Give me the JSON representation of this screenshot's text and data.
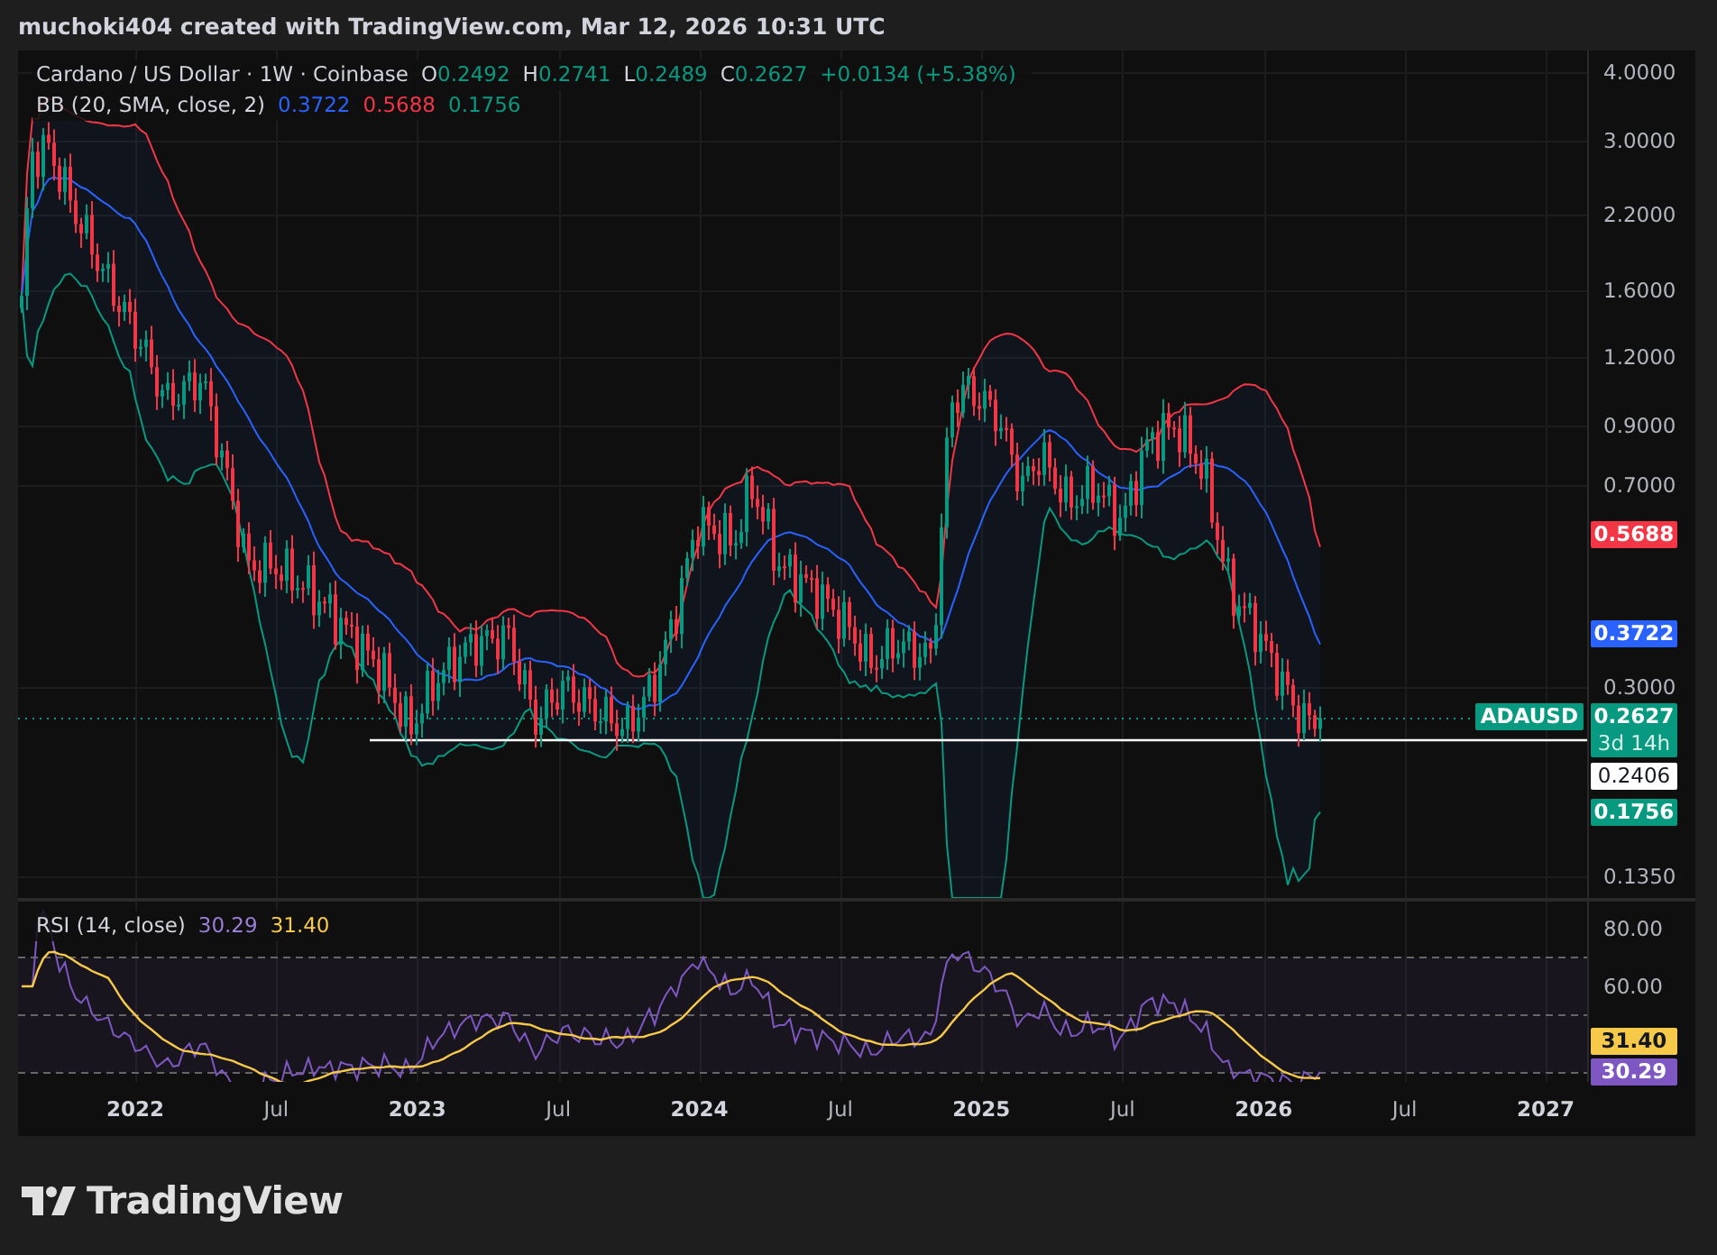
{
  "header": {
    "text": "muchoki404 created with TradingView.com, Mar 12, 2026 10:31 UTC"
  },
  "legend": {
    "symbol": "Cardano / US Dollar · 1W · Coinbase",
    "ohlc": [
      {
        "label": "O",
        "value": "0.2492"
      },
      {
        "label": "H",
        "value": "0.2741"
      },
      {
        "label": "L",
        "value": "0.2489"
      },
      {
        "label": "C",
        "value": "0.2627"
      }
    ],
    "change": "+0.0134 (+5.38%)"
  },
  "bb_legend": {
    "label": "BB (20, SMA, close, 2)",
    "values": [
      {
        "value": "0.3722",
        "color": "#2962ff"
      },
      {
        "value": "0.5688",
        "color": "#f23645"
      },
      {
        "value": "0.1756",
        "color": "#089981"
      }
    ]
  },
  "price_axis": {
    "ticks": [
      "4.0000",
      "3.0000",
      "2.2000",
      "1.6000",
      "1.2000",
      "0.9000",
      "0.7000",
      "0.3000",
      "0.1350"
    ]
  },
  "price_labels": [
    {
      "kind": "band",
      "value": "0.5688",
      "color": "#f23645"
    },
    {
      "kind": "band",
      "value": "0.3722",
      "color": "#2962ff"
    },
    {
      "kind": "last",
      "symbol": "ADAUSD",
      "value": "0.2627",
      "countdown": "3d 14h",
      "color": "#089981"
    },
    {
      "kind": "line",
      "value": "0.2406"
    },
    {
      "kind": "band",
      "value": "0.1756",
      "color": "#089981"
    }
  ],
  "rsi": {
    "label": "RSI (14, close)",
    "value": "30.29",
    "ma_value": "31.40",
    "ticks": [
      "80.00",
      "60.00"
    ],
    "axis_labels": [
      {
        "kind": "ma",
        "value": "31.40"
      },
      {
        "kind": "rsi",
        "value": "30.29"
      }
    ]
  },
  "time_axis": [
    "2022",
    "Jul",
    "2023",
    "Jul",
    "2024",
    "Jul",
    "2025",
    "Jul",
    "2026",
    "Jul",
    "2027"
  ],
  "logo": {
    "text": "TradingView"
  }
}
